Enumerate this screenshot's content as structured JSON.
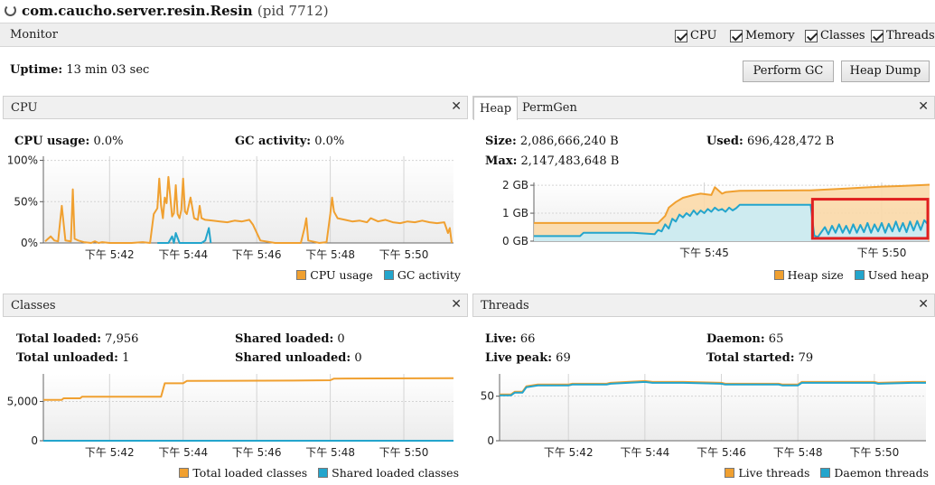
{
  "window": {
    "title": "com.caucho.server.resin.Resin",
    "pid": "(pid 7712)",
    "spinner_icon": "loading-spinner-icon"
  },
  "monitor_bar": {
    "label": "Monitor",
    "checkboxes": [
      {
        "label": "CPU",
        "checked": true
      },
      {
        "label": "Memory",
        "checked": true
      },
      {
        "label": "Classes",
        "checked": true
      },
      {
        "label": "Threads",
        "checked": true
      }
    ]
  },
  "uptime": {
    "label": "Uptime:",
    "value": "13 min 03 sec"
  },
  "buttons": {
    "perform_gc": "Perform GC",
    "heap_dump": "Heap Dump"
  },
  "colors": {
    "orange": "#f0a030",
    "blue": "#23a5cc",
    "highlight": "#e02020"
  },
  "cpu_panel": {
    "title": "CPU",
    "stats": [
      {
        "label": "CPU usage:",
        "value": "0.0%"
      },
      {
        "label": "GC activity:",
        "value": "0.0%"
      }
    ],
    "legend": [
      "CPU usage",
      "GC activity"
    ]
  },
  "heap_panel": {
    "tabs": [
      "Heap",
      "PermGen"
    ],
    "stats": [
      {
        "label": "Size:",
        "value": "2,086,666,240 B"
      },
      {
        "label": "Used:",
        "value": "696,428,472 B"
      },
      {
        "label": "Max:",
        "value": "2,147,483,648 B"
      }
    ],
    "legend": [
      "Heap size",
      "Used heap"
    ]
  },
  "classes_panel": {
    "title": "Classes",
    "stats": [
      {
        "label": "Total loaded:",
        "value": "7,956"
      },
      {
        "label": "Shared loaded:",
        "value": "0"
      },
      {
        "label": "Total unloaded:",
        "value": "1"
      },
      {
        "label": "Shared unloaded:",
        "value": "0"
      }
    ],
    "legend": [
      "Total loaded classes",
      "Shared loaded classes"
    ]
  },
  "threads_panel": {
    "title": "Threads",
    "stats": [
      {
        "label": "Live:",
        "value": "66"
      },
      {
        "label": "Daemon:",
        "value": "65"
      },
      {
        "label": "Live peak:",
        "value": "69"
      },
      {
        "label": "Total started:",
        "value": "79"
      }
    ],
    "legend": [
      "Live threads",
      "Daemon threads"
    ]
  },
  "chart_data": [
    {
      "id": "cpu",
      "type": "line",
      "x_ticks": [
        "下午 5:42",
        "下午 5:44",
        "下午 5:46",
        "下午 5:48",
        "下午 5:50"
      ],
      "x_tick_minutes": [
        42,
        44,
        46,
        48,
        50
      ],
      "xlim_minutes": [
        40.2,
        51.35
      ],
      "y_ticks": [
        "0%",
        "50%",
        "100%"
      ],
      "y_tick_values": [
        0,
        50,
        100
      ],
      "ylim": [
        0,
        105
      ],
      "grid": true,
      "legend_placement": "bottom-right",
      "series": [
        {
          "name": "CPU usage",
          "color": "#f0a030",
          "x": [
            40.25,
            40.4,
            40.5,
            40.6,
            40.7,
            40.8,
            40.95,
            41.0,
            41.05,
            41.15,
            41.3,
            41.5,
            41.6,
            41.7,
            41.8,
            42.0,
            42.3,
            42.6,
            42.9,
            43.1,
            43.2,
            43.3,
            43.35,
            43.4,
            43.45,
            43.5,
            43.55,
            43.6,
            43.7,
            43.75,
            43.8,
            43.85,
            43.9,
            43.95,
            44.0,
            44.05,
            44.1,
            44.2,
            44.3,
            44.4,
            44.45,
            44.5,
            44.6,
            44.8,
            45.0,
            45.2,
            45.4,
            45.6,
            45.8,
            45.9,
            46.1,
            46.5,
            46.9,
            47.2,
            47.3,
            47.35,
            47.4,
            47.5,
            47.7,
            47.9,
            48.0,
            48.05,
            48.1,
            48.2,
            48.4,
            48.6,
            48.8,
            49.0,
            49.1,
            49.3,
            49.5,
            49.7,
            49.9,
            50.1,
            50.3,
            50.5,
            50.7,
            50.9,
            51.1,
            51.2,
            51.25,
            51.3
          ],
          "y": [
            2,
            8,
            3,
            2,
            45,
            3,
            2,
            65,
            5,
            3,
            1,
            0,
            2,
            0,
            1,
            0,
            0,
            0,
            1,
            0,
            35,
            42,
            78,
            45,
            30,
            55,
            48,
            80,
            32,
            36,
            70,
            35,
            30,
            40,
            78,
            38,
            35,
            55,
            30,
            28,
            45,
            30,
            28,
            27,
            26,
            25,
            27,
            26,
            28,
            22,
            3,
            0,
            0,
            0,
            18,
            30,
            3,
            2,
            0,
            1,
            35,
            55,
            38,
            30,
            28,
            26,
            27,
            25,
            30,
            26,
            28,
            25,
            24,
            26,
            25,
            27,
            25,
            24,
            25,
            12,
            18,
            0
          ]
        },
        {
          "name": "GC activity",
          "color": "#23a5cc",
          "x": [
            43.3,
            43.6,
            43.7,
            43.75,
            43.8,
            43.9,
            44.1,
            44.3,
            44.5,
            44.6,
            44.7,
            44.75
          ],
          "y": [
            0,
            0,
            8,
            0,
            12,
            0,
            0,
            0,
            0,
            3,
            18,
            0
          ]
        }
      ]
    },
    {
      "id": "heap",
      "type": "area",
      "x_ticks": [
        "下午 5:45",
        "下午 5:50"
      ],
      "x_tick_minutes": [
        45,
        50
      ],
      "xlim_minutes": [
        40.2,
        51.35
      ],
      "y_ticks": [
        "0 GB",
        "1 GB",
        "2 GB"
      ],
      "y_tick_values": [
        0,
        1,
        2
      ],
      "ylim": [
        0,
        2.1
      ],
      "grid": true,
      "legend_placement": "bottom-right",
      "series": [
        {
          "name": "Heap size",
          "color": "#f0a030",
          "x": [
            40.2,
            43.7,
            43.9,
            44.0,
            44.2,
            44.4,
            44.7,
            44.9,
            45.2,
            45.3,
            45.5,
            45.6,
            46.0,
            48.0,
            48.5,
            49.0,
            49.5,
            50.0,
            50.5,
            51.0,
            51.35
          ],
          "y": [
            0.65,
            0.65,
            0.9,
            1.2,
            1.4,
            1.55,
            1.65,
            1.7,
            1.65,
            1.93,
            1.7,
            1.75,
            1.8,
            1.82,
            1.85,
            1.88,
            1.92,
            1.95,
            1.97,
            2.0,
            2.02
          ]
        },
        {
          "name": "Used heap",
          "color": "#23a5cc",
          "x": [
            40.2,
            41.5,
            41.6,
            43.0,
            43.6,
            43.7,
            43.8,
            43.9,
            44.0,
            44.1,
            44.2,
            44.3,
            44.4,
            44.5,
            44.6,
            44.7,
            44.8,
            44.9,
            45.0,
            45.1,
            45.2,
            45.3,
            45.4,
            45.5,
            45.6,
            45.7,
            45.8,
            45.9,
            46.0,
            47.0,
            48.0,
            48.1,
            48.2,
            48.4,
            48.5,
            48.6,
            48.7,
            48.8,
            48.9,
            49.0,
            49.1,
            49.2,
            49.3,
            49.4,
            49.5,
            49.6,
            49.7,
            49.8,
            49.9,
            50.0,
            50.1,
            50.2,
            50.3,
            50.4,
            50.5,
            50.6,
            50.7,
            50.8,
            50.9,
            51.0,
            51.1,
            51.2,
            51.3
          ],
          "y": [
            0.18,
            0.18,
            0.3,
            0.3,
            0.25,
            0.4,
            0.35,
            0.6,
            0.45,
            0.8,
            0.7,
            0.95,
            0.85,
            1.0,
            0.9,
            1.1,
            0.95,
            1.1,
            1.0,
            1.15,
            1.05,
            1.2,
            1.1,
            1.15,
            1.05,
            1.2,
            1.1,
            1.18,
            1.3,
            1.3,
            1.3,
            0.2,
            0.15,
            0.5,
            0.25,
            0.55,
            0.3,
            0.6,
            0.3,
            0.55,
            0.28,
            0.6,
            0.3,
            0.58,
            0.32,
            0.65,
            0.3,
            0.6,
            0.35,
            0.65,
            0.3,
            0.62,
            0.35,
            0.7,
            0.35,
            0.65,
            0.32,
            0.7,
            0.38,
            0.72,
            0.4,
            0.75,
            0.6
          ]
        }
      ],
      "annotation": {
        "type": "highlight-box",
        "x_range_minutes": [
          48.05,
          51.3
        ],
        "y_range": [
          0.1,
          1.5
        ],
        "color": "#e02020"
      }
    },
    {
      "id": "classes",
      "type": "line",
      "x_ticks": [
        "下午 5:42",
        "下午 5:44",
        "下午 5:46",
        "下午 5:48",
        "下午 5:50"
      ],
      "x_tick_minutes": [
        42,
        44,
        46,
        48,
        50
      ],
      "xlim_minutes": [
        40.2,
        51.35
      ],
      "y_ticks": [
        "0",
        "5,000"
      ],
      "y_tick_values": [
        0,
        5000
      ],
      "ylim": [
        0,
        8500
      ],
      "grid": true,
      "legend_placement": "bottom-right",
      "series": [
        {
          "name": "Total loaded classes",
          "color": "#f0a030",
          "x": [
            40.2,
            40.7,
            40.75,
            41.2,
            41.25,
            43.4,
            43.5,
            44.0,
            44.1,
            47.0,
            48.0,
            48.1,
            51.35
          ],
          "y": [
            5200,
            5200,
            5400,
            5400,
            5600,
            5600,
            7300,
            7300,
            7600,
            7650,
            7700,
            7900,
            7956
          ]
        },
        {
          "name": "Shared loaded classes",
          "color": "#23a5cc",
          "x": [
            40.2,
            51.35
          ],
          "y": [
            0,
            0
          ]
        }
      ]
    },
    {
      "id": "threads",
      "type": "line",
      "x_ticks": [
        "下午 5:42",
        "下午 5:44",
        "下午 5:46",
        "下午 5:48",
        "下午 5:50"
      ],
      "x_tick_minutes": [
        42,
        44,
        46,
        48,
        50
      ],
      "xlim_minutes": [
        40.2,
        51.35
      ],
      "y_ticks": [
        "0",
        "50"
      ],
      "y_tick_values": [
        0,
        50
      ],
      "ylim": [
        0,
        75
      ],
      "grid": true,
      "legend_placement": "bottom-right",
      "series": [
        {
          "name": "Live threads",
          "color": "#f0a030",
          "x": [
            40.2,
            40.5,
            40.6,
            40.8,
            40.9,
            41.2,
            42.0,
            42.1,
            43.0,
            43.1,
            44.0,
            44.2,
            45.0,
            46.0,
            46.1,
            47.5,
            47.6,
            48.0,
            48.1,
            49.0,
            50.0,
            50.1,
            51.0,
            51.35
          ],
          "y": [
            52,
            52,
            55,
            55,
            61,
            63,
            63,
            64,
            64,
            65,
            67,
            66,
            66,
            65,
            64,
            64,
            63,
            63,
            66,
            66,
            66,
            65,
            66,
            66
          ]
        },
        {
          "name": "Daemon threads",
          "color": "#23a5cc",
          "x": [
            40.2,
            40.5,
            40.6,
            40.8,
            40.9,
            41.2,
            42.0,
            42.1,
            43.0,
            43.1,
            44.0,
            44.2,
            45.0,
            46.0,
            46.1,
            47.5,
            47.6,
            48.0,
            48.1,
            49.0,
            50.0,
            50.1,
            51.0,
            51.35
          ],
          "y": [
            51,
            51,
            54,
            54,
            60,
            62,
            62,
            63,
            63,
            64,
            66,
            65,
            65,
            64,
            63,
            63,
            62,
            62,
            65,
            65,
            65,
            64,
            65,
            65
          ]
        }
      ]
    }
  ]
}
